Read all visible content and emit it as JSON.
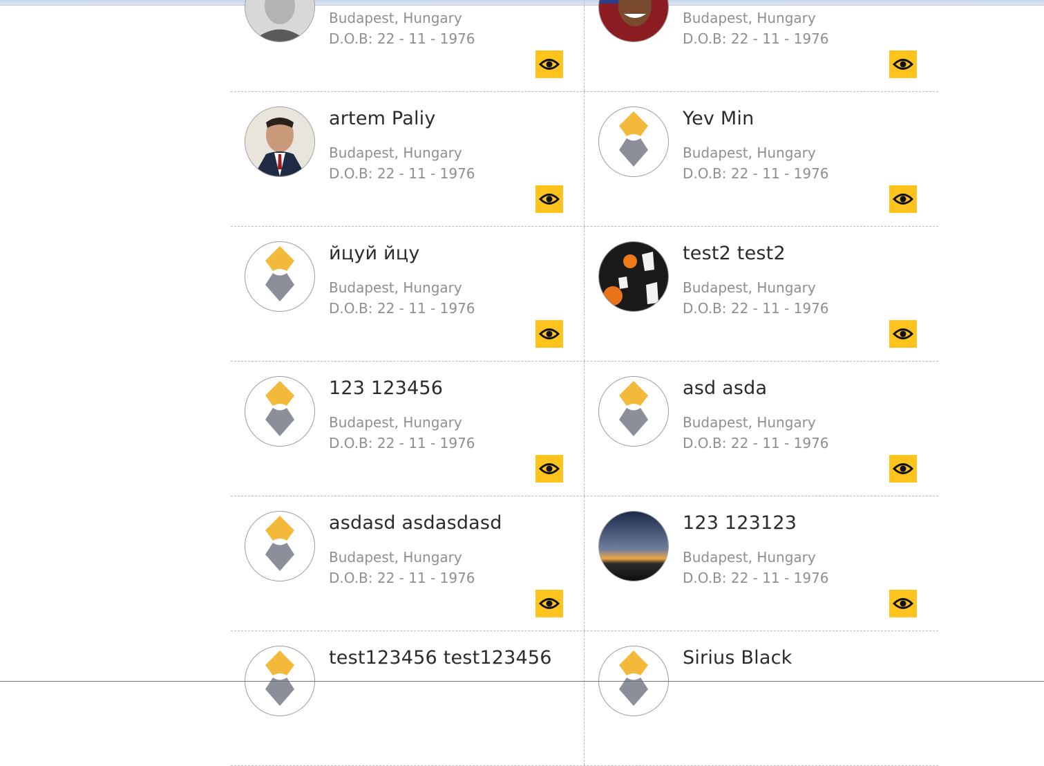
{
  "cards": [
    {
      "name": "",
      "location": "Budapest, Hungary",
      "dob": "D.O.B: 22 - 11 - 1976",
      "avatar": "photo-man-gray",
      "view_icon": "eye-icon"
    },
    {
      "name": "",
      "location": "Budapest, Hungary",
      "dob": "D.O.B: 22 - 11 - 1976",
      "avatar": "photo-man-smiling",
      "view_icon": "eye-icon"
    },
    {
      "name": "artem Paliy",
      "location": "Budapest, Hungary",
      "dob": "D.O.B: 22 - 11 - 1976",
      "avatar": "photo-man-suit",
      "view_icon": "eye-icon"
    },
    {
      "name": "Yev Min",
      "location": "Budapest, Hungary",
      "dob": "D.O.B: 22 - 11 - 1976",
      "avatar": "default-avatar",
      "view_icon": "eye-icon"
    },
    {
      "name": "йцуй йцу",
      "location": "Budapest, Hungary",
      "dob": "D.O.B: 22 - 11 - 1976",
      "avatar": "default-avatar",
      "view_icon": "eye-icon"
    },
    {
      "name": "test2 test2",
      "location": "Budapest, Hungary",
      "dob": "D.O.B: 22 - 11 - 1976",
      "avatar": "halloween-image",
      "view_icon": "eye-icon"
    },
    {
      "name": "123 123456",
      "location": "Budapest, Hungary",
      "dob": "D.O.B: 22 - 11 - 1976",
      "avatar": "default-avatar",
      "view_icon": "eye-icon"
    },
    {
      "name": "asd asda",
      "location": "Budapest, Hungary",
      "dob": "D.O.B: 22 - 11 - 1976",
      "avatar": "default-avatar",
      "view_icon": "eye-icon"
    },
    {
      "name": "asdasd asdasdasd",
      "location": "Budapest, Hungary",
      "dob": "D.O.B: 22 - 11 - 1976",
      "avatar": "default-avatar",
      "view_icon": "eye-icon"
    },
    {
      "name": "123 123123",
      "location": "Budapest, Hungary",
      "dob": "D.O.B: 22 - 11 - 1976",
      "avatar": "sunset-image",
      "view_icon": "eye-icon"
    },
    {
      "name": "test123456 test123456",
      "location": "",
      "dob": "",
      "avatar": "default-avatar",
      "view_icon": "eye-icon"
    },
    {
      "name": "Sirius Black",
      "location": "",
      "dob": "",
      "avatar": "default-avatar",
      "view_icon": "eye-icon"
    }
  ],
  "colors": {
    "accent": "#ffc31e",
    "name_text": "#2b2b2b",
    "meta_text": "#8f8f8f",
    "avatar_orange": "#f2b93b",
    "avatar_gray": "#8a8f99"
  }
}
